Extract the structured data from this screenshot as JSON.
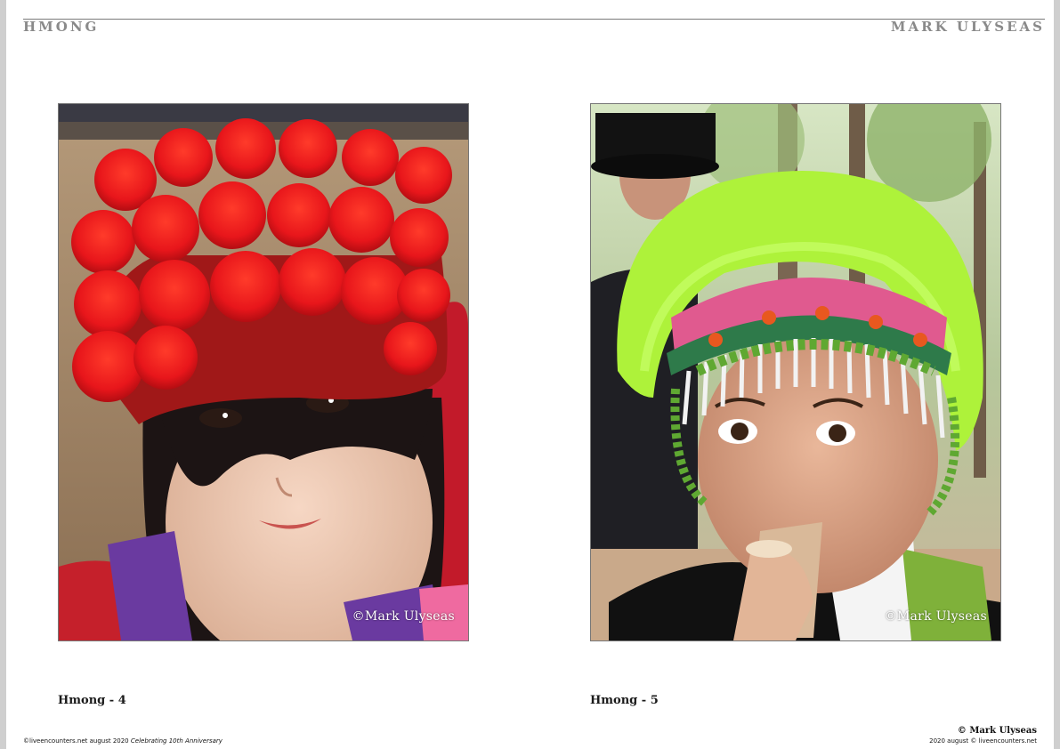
{
  "header": {
    "left_title": "HMONG",
    "right_title": "MARK ULYSEAS"
  },
  "photos": [
    {
      "description_icon": "photo-girl-red-pompom-hat",
      "watermark": "©Mark Ulyseas",
      "caption": "Hmong - 4"
    },
    {
      "description_icon": "photo-child-green-feather-headdress",
      "watermark": "©Mark Ulyseas",
      "caption": "Hmong - 5"
    }
  ],
  "footer": {
    "left_text": "©liveencounters.net august 2020 ",
    "left_italic": "Celebrating 10th Anniversary",
    "right_top": "© Mark Ulyseas",
    "right_bottom": "2020 august © liveencounters.net"
  },
  "colors": {
    "header_text": "#8a8a8a",
    "rule": "#7a7a7a",
    "pompom_red": "#e8161b",
    "hat_red": "#a01818",
    "feather_green": "#aef23a"
  }
}
